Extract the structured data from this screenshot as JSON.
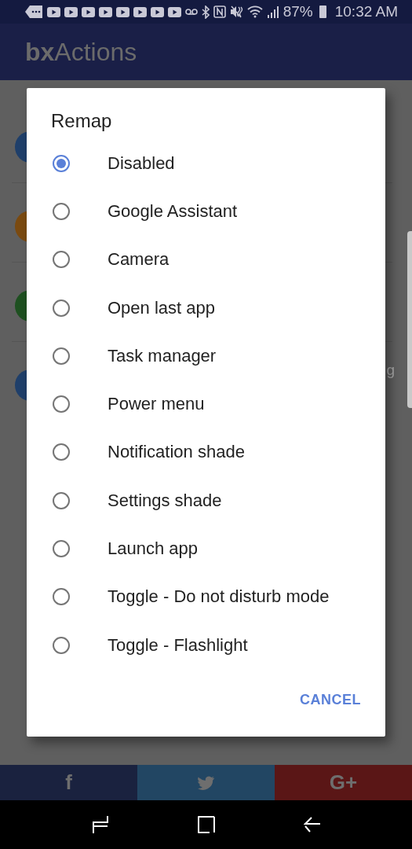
{
  "status_bar": {
    "battery": "87%",
    "time": "10:32 AM"
  },
  "app_bar": {
    "title_bold": "bx",
    "title_rest": "Actions"
  },
  "background_list": [
    {
      "color": "#1f3f6a"
    },
    {
      "color": "#7a4a10"
    },
    {
      "color": "#1e5020"
    },
    {
      "color": "#1f3f6a",
      "text": "g"
    }
  ],
  "dialog": {
    "title": "Remap",
    "options": [
      {
        "label": "Disabled",
        "selected": true
      },
      {
        "label": "Google Assistant",
        "selected": false
      },
      {
        "label": "Camera",
        "selected": false
      },
      {
        "label": "Open last app",
        "selected": false
      },
      {
        "label": "Task manager",
        "selected": false
      },
      {
        "label": "Power menu",
        "selected": false
      },
      {
        "label": "Notification shade",
        "selected": false
      },
      {
        "label": "Settings shade",
        "selected": false
      },
      {
        "label": "Launch app",
        "selected": false
      },
      {
        "label": "Toggle - Do not disturb mode",
        "selected": false
      },
      {
        "label": "Toggle - Flashlight",
        "selected": false
      }
    ],
    "button": "CANCEL"
  },
  "share_bar": [
    {
      "kind": "facebook",
      "label": "f"
    },
    {
      "kind": "twitter"
    },
    {
      "kind": "googleplus",
      "label": "G+"
    }
  ]
}
